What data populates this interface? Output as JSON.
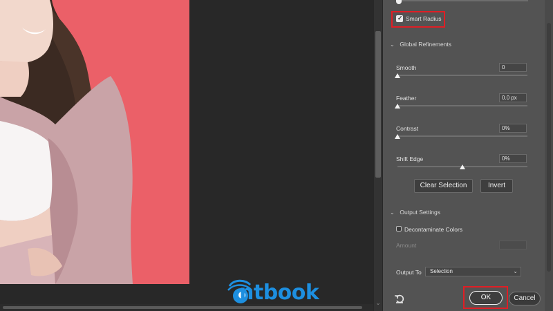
{
  "panel": {
    "smart_radius": {
      "label": "Smart Radius",
      "checked": true
    },
    "global_refinements": {
      "title": "Global Refinements",
      "smooth": {
        "label": "Smooth",
        "value": "0",
        "level": 0
      },
      "feather": {
        "label": "Feather",
        "value": "0.0 px",
        "level": 0
      },
      "contrast": {
        "label": "Contrast",
        "value": "0%",
        "level": 0
      },
      "shift_edge": {
        "label": "Shift Edge",
        "value": "0%",
        "level": 0.5
      },
      "clear_selection_label": "Clear Selection",
      "invert_label": "Invert"
    },
    "output_settings": {
      "title": "Output Settings",
      "decontaminate": {
        "label": "Decontaminate Colors",
        "checked": false
      },
      "amount_label": "Amount",
      "output_to_label": "Output To",
      "output_to_value": "Selection"
    },
    "footer": {
      "reset_icon": "reset-icon",
      "ok_label": "OK",
      "cancel_label": "Cancel"
    }
  },
  "watermark": {
    "text": "ntbook"
  },
  "colors": {
    "canvas_bg": "#282828",
    "photo_bg": "#eb6068",
    "panel_bg": "#535353",
    "highlight": "#e01e25",
    "logo_blue": "#1d8fe0"
  }
}
